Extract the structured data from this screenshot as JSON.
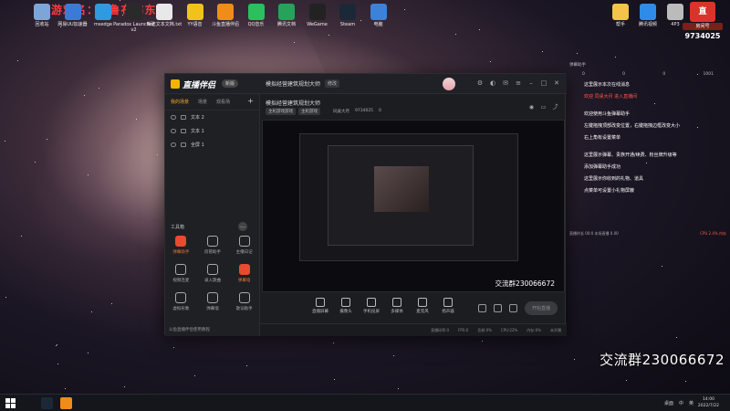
{
  "overlay": {
    "top_red_text": "游戏名：◎鲁布布东线",
    "group_text": "交流群230066672"
  },
  "desktop_icons_left": [
    {
      "label": "回收站",
      "icon": "recycle-bin-icon",
      "color": "#7ca6d8"
    },
    {
      "label": "网易UU加速器",
      "icon": "uu-accelerator-icon",
      "color": "#3b7bd8"
    },
    {
      "label": "msedge",
      "icon": "edge-icon",
      "color": "#2f9ae0"
    },
    {
      "label": "Paradox Launcher v2",
      "icon": "paradox-icon",
      "color": "#2a2a2a"
    },
    {
      "label": "新建文本文档.txt",
      "icon": "text-file-icon",
      "color": "#e8e8e8"
    },
    {
      "label": "YY语音",
      "icon": "yy-icon",
      "color": "#f2c21b"
    },
    {
      "label": "斗鱼直播伴侣",
      "icon": "douyu-companion-icon",
      "color": "#f08c1a"
    },
    {
      "label": "QQ音乐",
      "icon": "qq-music-icon",
      "color": "#2bbf5e"
    },
    {
      "label": "腾讯文档",
      "icon": "tencent-doc-icon",
      "color": "#25a35a"
    },
    {
      "label": "WeGame",
      "icon": "wegame-icon",
      "color": "#222"
    },
    {
      "label": "Steam",
      "icon": "steam-icon",
      "color": "#1b2838"
    },
    {
      "label": "电脑",
      "icon": "computer-icon",
      "color": "#3b82d8"
    }
  ],
  "desktop_icons_right": [
    {
      "label": "帮手",
      "icon": "file-icon",
      "color": "#f3c34b"
    },
    {
      "label": "腾讯视频",
      "icon": "tencent-video-icon",
      "color": "#2f8be8"
    },
    {
      "label": "4P3",
      "icon": "app-icon",
      "color": "#bbb"
    }
  ],
  "room_panel": {
    "label": "房间号",
    "number": "9734025"
  },
  "app": {
    "logo": "直播伴侣",
    "version": "新版",
    "room_title": "模拟经营建筑规划大师",
    "title_badge": "修改",
    "tags": [
      "主机游戏游戏",
      "主机游戏"
    ],
    "meta": [
      "同桌大月",
      "9734025",
      "0"
    ],
    "tabs": [
      "我的场景",
      "场景",
      "观看场"
    ],
    "add_label": "+",
    "sources": [
      "文本 2",
      "文本 1",
      "全屏 1"
    ],
    "tools_title": "工具箱",
    "tools": [
      {
        "label": "弹幕助手",
        "hot": true,
        "icon": "danmaku-helper-icon"
      },
      {
        "label": "房管助手",
        "hot": false,
        "icon": "room-admin-icon"
      },
      {
        "label": "主播日记",
        "hot": false,
        "icon": "diary-icon"
      },
      {
        "label": "视频连麦",
        "hot": false,
        "icon": "video-link-icon"
      },
      {
        "label": "录入歌曲",
        "hot": false,
        "icon": "song-icon"
      },
      {
        "label": "弹幕墙",
        "hot": true,
        "icon": "danmaku-wall-icon"
      },
      {
        "label": "虚拟形象",
        "hot": false,
        "icon": "avatar-figure-icon"
      },
      {
        "label": "弹幕墙",
        "hot": false,
        "icon": "wall-icon"
      },
      {
        "label": "歌词助手",
        "hot": false,
        "icon": "lyrics-icon"
      }
    ],
    "left_footer": "斗鱼直播伴侣使用教程",
    "preview_caption": "交流群230066672",
    "bottom_tools": [
      "直播屏幕",
      "摄像头",
      "手机投屏",
      "多媒体",
      "麦克风",
      "扬声器"
    ],
    "start_live": "开始直播",
    "status": [
      "直播码率:0",
      "FPS:0",
      "丢帧:0%",
      "CPU:22%",
      "内存:0%",
      "未开播"
    ]
  },
  "chat": {
    "header": "弹幕助手",
    "stats": [
      "0",
      "0",
      "0",
      "1001"
    ],
    "lines": [
      {
        "text": "这里展示本次在线消息",
        "red": false
      },
      {
        "text": "欢迎 同桌大月 进入直播间",
        "red": true
      },
      {
        "text": "欢迎使用斗鱼弹幕助手",
        "red": false
      },
      {
        "text": "左键拖拽顶部改变位置，右键拖拽边框改变大小",
        "red": false
      },
      {
        "text": "右上角有设置菜单",
        "red": false
      },
      {
        "text": "这里展示弹幕、贵族开通/续费、粉丝牌升级等",
        "red": false
      },
      {
        "text": "添加弹幕助手成功",
        "red": false
      },
      {
        "text": "这里展示你收到的礼物、道具",
        "red": false
      },
      {
        "text": "点菜单可设置小礼物屏蔽",
        "red": false
      }
    ],
    "footer_left": "直播时长 00:0 本场直播 0.00",
    "footer_right": "CPU 2.4% 内存"
  },
  "taskbar": {
    "tray": [
      "桌面",
      "中",
      "英"
    ],
    "time": "14:00",
    "date": "2022/7/22"
  }
}
